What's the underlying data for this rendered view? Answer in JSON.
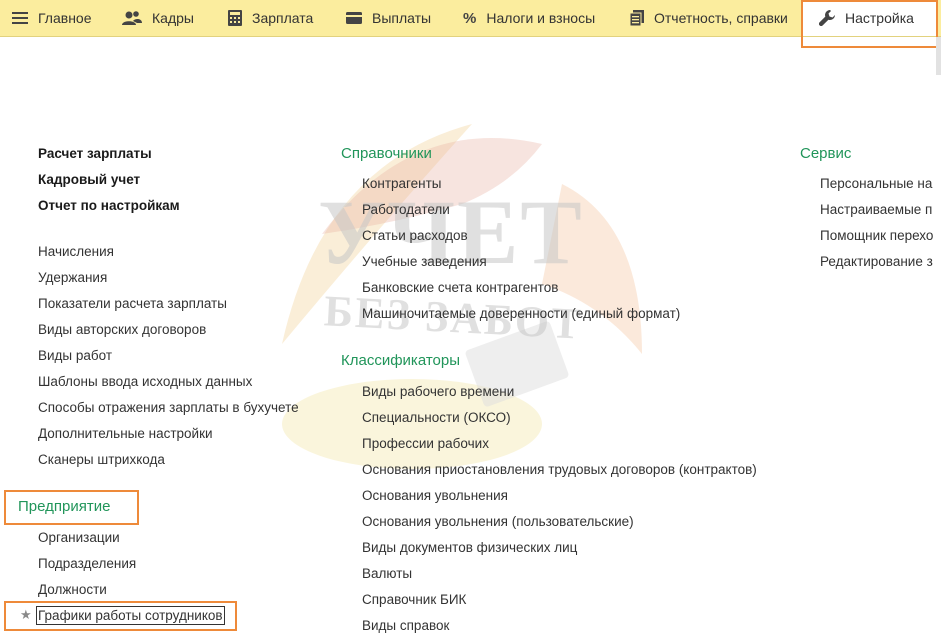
{
  "topnav": {
    "items": [
      {
        "label": "Главное",
        "icon": "hamburger-menu-icon"
      },
      {
        "label": "Кадры",
        "icon": "people-icon"
      },
      {
        "label": "Зарплата",
        "icon": "calculator-icon"
      },
      {
        "label": "Выплаты",
        "icon": "wallet-icon"
      },
      {
        "label": "Налоги и взносы",
        "icon": "percent-icon"
      },
      {
        "label": "Отчетность, справки",
        "icon": "reports-icon"
      },
      {
        "label": "Настройка",
        "icon": "wrench-icon"
      }
    ],
    "active": "Настройка"
  },
  "watermark": {
    "line1": "УЧЕТ",
    "line2": "БЕЗ ЗАБОТ"
  },
  "left_column": {
    "bold_links": [
      "Расчет зарплаты",
      "Кадровый учет",
      "Отчет по настройкам"
    ],
    "links": [
      "Начисления",
      "Удержания",
      "Показатели расчета зарплаты",
      "Виды авторских договоров",
      "Виды работ",
      "Шаблоны ввода исходных данных",
      "Способы отражения зарплаты в бухучете",
      "Дополнительные настройки",
      "Сканеры штрихкода"
    ],
    "enterprise_title": "Предприятие",
    "enterprise_links": [
      "Организации",
      "Подразделения",
      "Должности",
      "Графики работы сотрудников"
    ]
  },
  "middle_column": {
    "references_title": "Справочники",
    "references": [
      "Контрагенты",
      "Работодатели",
      "Статьи расходов",
      "Учебные заведения",
      "Банковские счета контрагентов",
      "Машиночитаемые доверенности (единый формат)"
    ],
    "classifiers_title": "Классификаторы",
    "classifiers": [
      "Виды рабочего времени",
      "Специальности (ОКСО)",
      "Профессии рабочих",
      "Основания приостановления трудовых договоров (контрактов)",
      "Основания увольнения",
      "Основания увольнения (пользовательские)",
      "Виды документов физических лиц",
      "Валюты",
      "Справочник БИК",
      "Виды справок"
    ]
  },
  "right_column": {
    "title": "Сервис",
    "links": [
      "Персональные на",
      "Настраиваемые п",
      "Помощник перехо",
      "Редактирование з"
    ]
  },
  "colors": {
    "topbar": "#fbed9e",
    "section_title": "#21955a",
    "highlight": "#ee8a3a"
  }
}
